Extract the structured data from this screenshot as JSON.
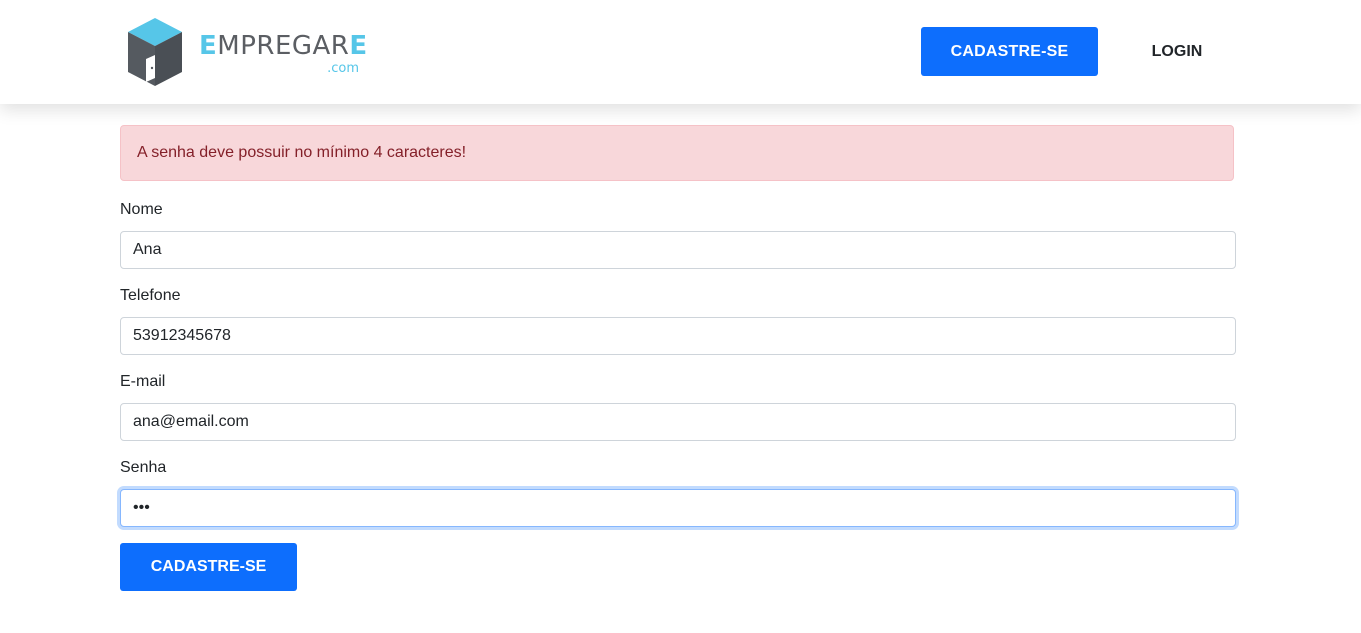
{
  "header": {
    "logo": {
      "text_accent": "E",
      "text_main": "MPREGAR",
      "text_end": "E",
      "sub": ".com",
      "colors": {
        "accent": "#56c6e8",
        "text": "#5b5e63",
        "cube": "#555a60"
      }
    },
    "nav": {
      "signup_label": "CADASTRE-SE",
      "login_label": "LOGIN"
    }
  },
  "alert": {
    "message": "A senha deve possuir no mínimo 4 caracteres!"
  },
  "form": {
    "name": {
      "label": "Nome",
      "value": "Ana"
    },
    "phone": {
      "label": "Telefone",
      "value": "53912345678"
    },
    "email": {
      "label": "E-mail",
      "value": "ana@email.com"
    },
    "password": {
      "label": "Senha",
      "value": "abc"
    },
    "submit_label": "CADASTRE-SE"
  },
  "colors": {
    "primary": "#0d6efd",
    "alert_bg": "#f8d7da",
    "alert_text": "#842029"
  }
}
